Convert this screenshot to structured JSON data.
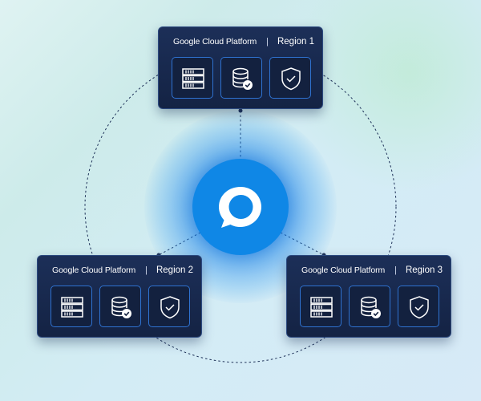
{
  "diagram": {
    "hub": {
      "icon": "chat-bubble-icon",
      "color": "#0f87e6"
    },
    "regions": [
      {
        "brand": "Google Cloud Platform",
        "separator": "|",
        "label": "Region 1",
        "services": [
          "server-rack-icon",
          "database-check-icon",
          "shield-check-icon"
        ]
      },
      {
        "brand": "Google Cloud Platform",
        "separator": "|",
        "label": "Region 2",
        "services": [
          "server-rack-icon",
          "database-check-icon",
          "shield-check-icon"
        ]
      },
      {
        "brand": "Google Cloud Platform",
        "separator": "|",
        "label": "Region 3",
        "services": [
          "server-rack-icon",
          "database-check-icon",
          "shield-check-icon"
        ]
      }
    ],
    "colors": {
      "card": "#1a2c54",
      "tile_border": "#2f72d0",
      "link": "#1e3158"
    }
  }
}
